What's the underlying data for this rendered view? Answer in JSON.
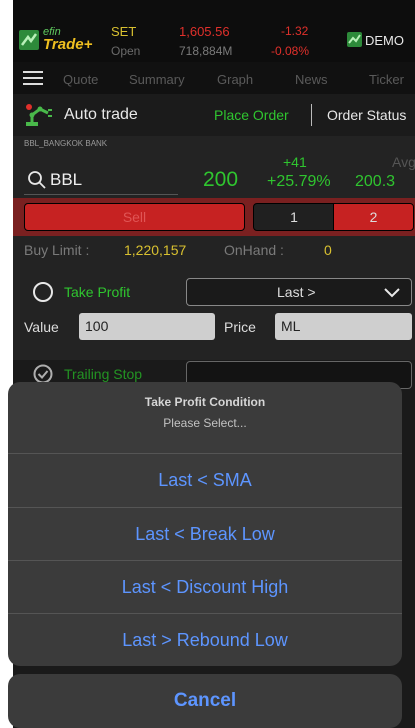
{
  "market": {
    "index_name": "SET",
    "index_value": "1,605.56",
    "change": "-1.32",
    "session": "Open",
    "volume": "718,884M",
    "change_pct": "-0.08%",
    "demo_label": "DEMO"
  },
  "logo": {
    "line1": "efin",
    "line2": "Trade+"
  },
  "tabs": [
    "Quote",
    "Summary",
    "Graph",
    "News",
    "Ticker"
  ],
  "autotrade": {
    "title": "Auto trade",
    "place_order": "Place Order",
    "order_status": "Order Status"
  },
  "stock": {
    "subtitle": "BBL_BANGKOK BANK",
    "symbol": "BBL",
    "price": "200",
    "change": "+41",
    "change_pct": "+25.79%",
    "avg_label": "Avg",
    "avg_value": "200.3"
  },
  "order_side": {
    "sell_label": "Sell",
    "seg1": "1",
    "seg2": "2"
  },
  "limits": {
    "buy_limit_label": "Buy Limit :",
    "buy_limit_value": "1,220,157",
    "onhand_label": "OnHand :",
    "onhand_value": "0"
  },
  "take_profit": {
    "label": "Take Profit",
    "selected": "Last >",
    "value_label": "Value",
    "value": "100",
    "price_label": "Price",
    "price": "ML"
  },
  "trailing_stop": {
    "label": "Trailing Stop"
  },
  "action_sheet": {
    "title": "Take Profit Condition",
    "subtitle": "Please Select...",
    "options": [
      "Last < SMA",
      "Last < Break Low",
      "Last < Discount High",
      "Last > Rebound Low"
    ],
    "cancel": "Cancel"
  },
  "colors": {
    "gain": "#2fc52f",
    "loss": "#e0302b",
    "accent_yellow": "#d8c030",
    "ios_blue": "#5d95ff",
    "sell_red": "#c62222"
  },
  "icons": {
    "menu": "hamburger-icon",
    "robot": "robot-arm-icon",
    "search": "search-icon",
    "dropdown": "chevron-down-icon",
    "check": "checkmark-circle-icon"
  }
}
